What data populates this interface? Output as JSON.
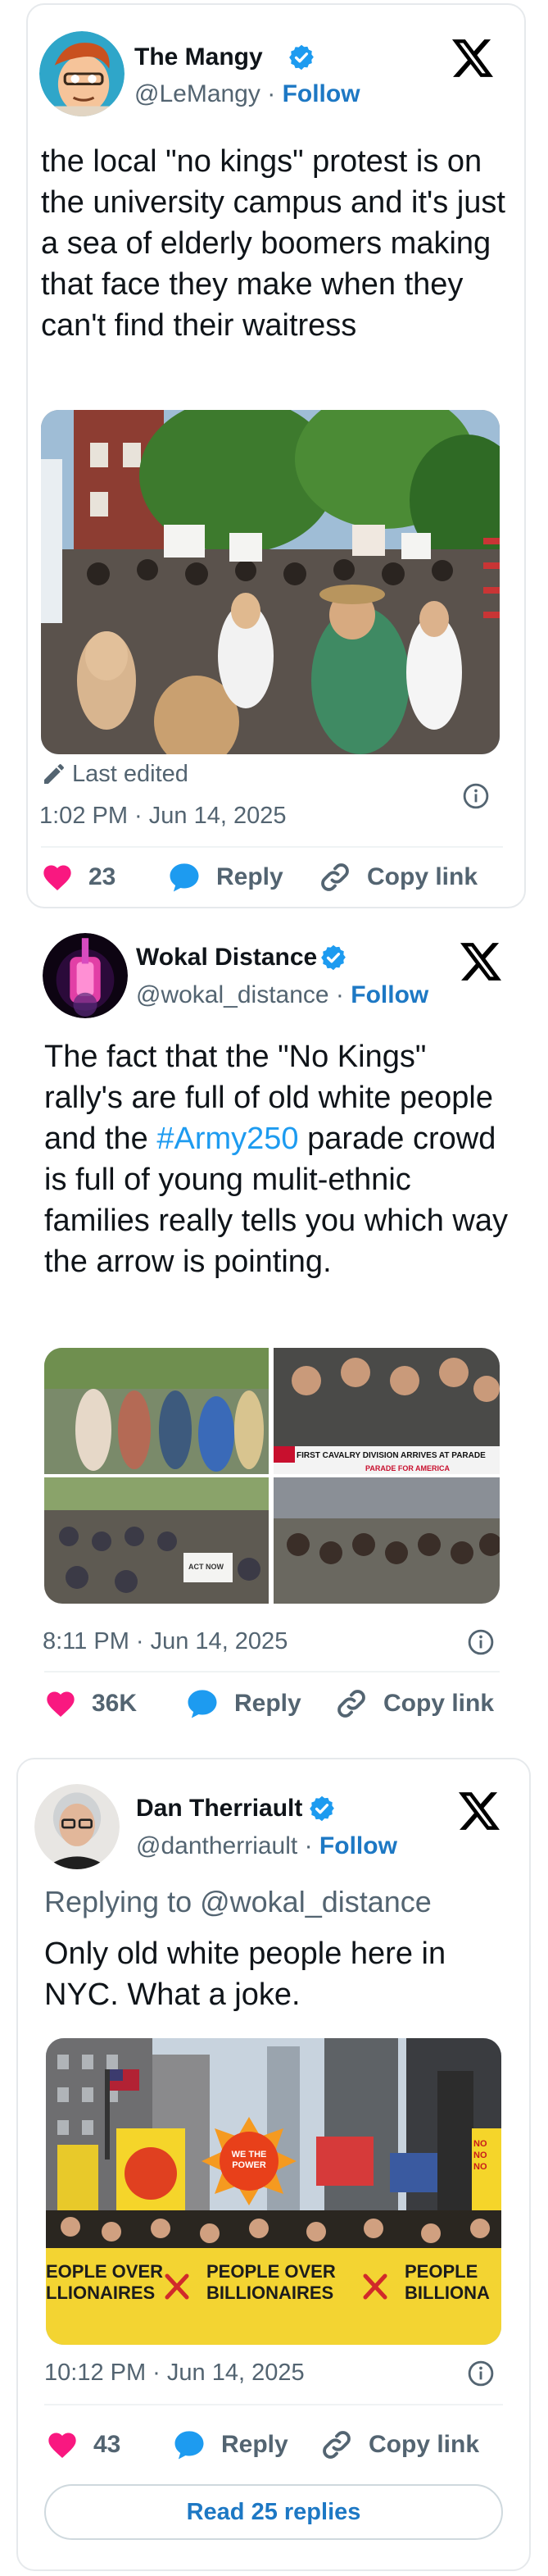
{
  "tweets": [
    {
      "display_name": "The Mangy",
      "handle": "@LeMangy",
      "separator": "·",
      "follow_label": "Follow",
      "body": "the local \"no kings\" protest is on the university campus and it's just a sea of elderly boomers making that face they make when they can't find their waitress",
      "edited_label": "Last edited",
      "timestamp": "1:02 PM · Jun 14, 2025",
      "likes": "23",
      "reply_label": "Reply",
      "copy_label": "Copy link"
    },
    {
      "display_name": "Wokal Distance",
      "handle": "@wokal_distance",
      "separator": "·",
      "follow_label": "Follow",
      "body_before": "The fact that the \"No Kings\" rally's are full of old white people and the ",
      "hashtag": "#Army250",
      "body_after": " parade crowd is full of young mulit-ethnic families really tells you which way the arrow is pointing.",
      "media_caption_1": "FIRST CAVALRY DIVISION ARRIVES AT PARADE",
      "media_caption_2": "PARADE FOR AMERICA",
      "media_sign": "ACT NOW",
      "timestamp": "8:11 PM · Jun 14, 2025",
      "likes": "36K",
      "reply_label": "Reply",
      "copy_label": "Copy link"
    },
    {
      "display_name": "Dan Therriault",
      "handle": "@dantherriault",
      "separator": "·",
      "follow_label": "Follow",
      "replying_to": "Replying to @wokal_distance",
      "body": "Only old white people here in NYC. What a joke.",
      "banner_text_1": "EOPLE OVER",
      "banner_text_1b": "LLIONAIRES",
      "banner_text_2": "PEOPLE OVER",
      "banner_text_2b": "BILLIONAIRES",
      "banner_text_3": "PEOPLE",
      "banner_text_3b": "BILLIONA",
      "sun_sign": "WE THE POWER",
      "side_sign": "NO NO NO",
      "timestamp": "10:12 PM · Jun 14, 2025",
      "likes": "43",
      "reply_label": "Reply",
      "copy_label": "Copy link",
      "read_replies": "Read 25 replies"
    }
  ],
  "colors": {
    "like_red": "#f91880",
    "reply_blue": "#1d9bf0",
    "verified_blue": "#1d9bf0",
    "follow_blue": "#1d78c4",
    "gray_text": "#536471"
  }
}
